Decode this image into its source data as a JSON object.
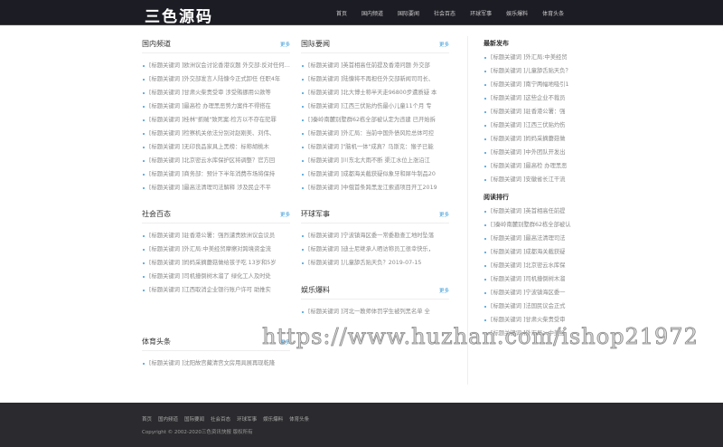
{
  "header": {
    "logo": "三色源码",
    "nav": [
      "首页",
      "国内频道",
      "国际要闻",
      "社会百态",
      "环球军事",
      "娱乐爆料",
      "体育头条"
    ]
  },
  "more": "更多",
  "sections": {
    "domestic": {
      "title": "国内频道",
      "items": [
        "[标题关键词 ]欧洲议会讨论香港议题 外交部:反对任何干涉",
        "[标题关键词 ]外交部发言人陆慷今正式卸任 任职4年",
        "[标题关键词 ]甘肃火柴贵受审 涉受贿挪用公款等",
        "[标题关键词 ]最高检 办理黑恶势力案件不得搭在",
        "[标题关键词 ]桂林\"抓贼\"致死案:检方以不存在犯罪",
        "[标题关键词 ]检察机关依法分别对赵刚美、刘伟、",
        "[标题关键词 ]无印良品家具上黑榜：标称胡桃木",
        "[标题关键词 ]北京密云水库保护区将调整？官方回",
        "[标题关键词 ]商务部：预计下半年消费市场将保持",
        "[标题关键词 ]最高法清理司法解释 涉及民企不平"
      ]
    },
    "international": {
      "title": "国际要闻",
      "items": [
        "[标题关键词 ]英首相高任前提及香港问题 外交部",
        "[标题关键词 ]陆慷将不再担任外交部新闻司司长、",
        "[标题关键词 ]北大博士称半天走96800步遭质疑 本",
        "[标题关键词 ]江西三伏贴灼伤最小儿童11个月 专",
        "[]秦岭南麓别墅群62栋全部被认定为违建 已开始拆",
        "[标题关键词 ]外汇局：当前中国外债风险总体可控",
        "[标题关键词 ]\"脑机一体\"成真？马斯克：猴子已能",
        "[标题关键词 ]川东北大雨不断 渠江水位上涨沿江",
        "[标题关键词 ]成都海关截获疑似象牙和犀牛制品20",
        "[标题关键词 ]中俄首条跨黑龙江索道项目开工2019"
      ]
    },
    "society": {
      "title": "社会百态",
      "items": [
        "[标题关键词 ]驻香港公署：强烈谴责欧洲议会议员",
        "[标题关键词 ]外汇局:中美经贸摩擦对跨境资金流",
        "[标题关键词 ]妈妈采摘蘑菇做给孩子吃 13岁和5岁",
        "[标题关键词 ]司机撞倒树木溜了 绿化工人及时处",
        "[标题关键词 ]江西取消企业银行账户许可 助推实"
      ]
    },
    "military": {
      "title": "环球军事",
      "items": [
        "[标题关键词 ]宁波镇海区委一常委勘查工地时坠落",
        "[标题关键词 ]迪士尼继承人晒访称员工很幸快乐，",
        "[标题关键词 ]儿童舔舌贴天负？2019-07-15"
      ]
    },
    "entertainment": {
      "title": "娱乐爆料",
      "items": [
        "[标题关键词 ]河北一教师体罚学生被列黑名单 全"
      ]
    },
    "sports": {
      "title": "体育头条",
      "items": [
        "[标题关键词 ]沈阳故宫藏清宫文房用具展再现乾隆"
      ]
    }
  },
  "sidebar": {
    "latest": {
      "title": "最新发布",
      "items": [
        "[标题关键词 ]外汇局:中美经贸",
        "[标题关键词 ]儿童舔舌贴天负？",
        "[标题关键词 ]南宁两幅地吸引1",
        "[标题关键词 ]这些企业不裁员",
        "[标题关键词 ]驻香港公署：强",
        "[标题关键词 ]江西三伏贴灼伤",
        "[标题关键词 ]妈妈采摘蘑菇做",
        "[标题关键词 ]中外团队开发出",
        "[标题关键词 ]最高检 办理黑恶",
        "[标题关键词 ]安徽省长江干流"
      ]
    },
    "popular": {
      "title": "阅读排行",
      "items": [
        "[标题关键词 ]英首相高任前提",
        "[]秦岭南麓别墅群62栋全部被认",
        "[标题关键词 ]最高法清理司法",
        "[标题关键词 ]成都海关截获疑",
        "[标题关键词 ]北京密云水库保",
        "[标题关键词 ]司机撞倒树木溜",
        "[标题关键词 ]宁波镇海区委一",
        "[标题关键词 ]法国民议会正式",
        "[标题关键词 ]甘肃火柴贵受审",
        "[标题关键词 ]外汇局：中美经"
      ]
    }
  },
  "watermark": "https://www.huzhan.com/ishop21972",
  "footer": {
    "nav": [
      "首页",
      "国内频道",
      "国际要闻",
      "社会百态",
      "环球军事",
      "娱乐爆料",
      "体育头条"
    ],
    "copyright": "Copyright © 2002-2020三色资讯快报 版权所有"
  }
}
